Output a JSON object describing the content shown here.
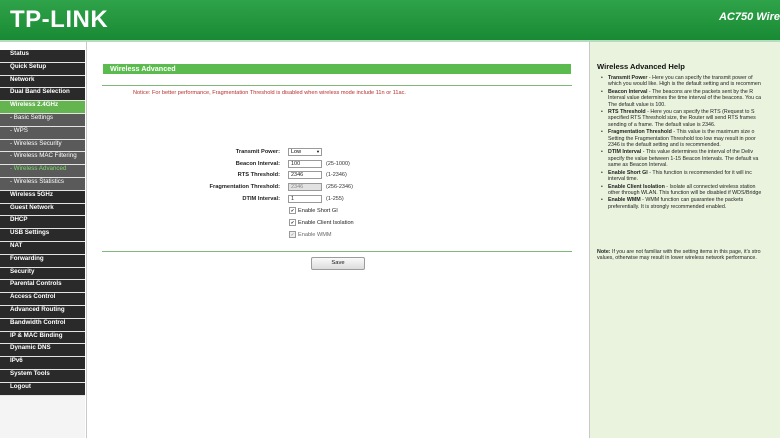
{
  "header": {
    "brand": "TP-LINK",
    "model": "AC750 Wire"
  },
  "sidebar": {
    "items": [
      {
        "label": "Status",
        "type": "top"
      },
      {
        "label": "Quick Setup",
        "type": "top"
      },
      {
        "label": "Network",
        "type": "top"
      },
      {
        "label": "Dual Band Selection",
        "type": "top"
      },
      {
        "label": "Wireless 2.4GHz",
        "type": "active"
      },
      {
        "label": "- Basic Settings",
        "type": "sub"
      },
      {
        "label": "- WPS",
        "type": "sub"
      },
      {
        "label": "- Wireless Security",
        "type": "sub"
      },
      {
        "label": "- Wireless MAC Filtering",
        "type": "sub"
      },
      {
        "label": "- Wireless Advanced",
        "type": "current"
      },
      {
        "label": "- Wireless Statistics",
        "type": "sub"
      },
      {
        "label": "Wireless 5GHz",
        "type": "top"
      },
      {
        "label": "Guest Network",
        "type": "top"
      },
      {
        "label": "DHCP",
        "type": "top"
      },
      {
        "label": "USB Settings",
        "type": "top"
      },
      {
        "label": "NAT",
        "type": "top"
      },
      {
        "label": "Forwarding",
        "type": "top"
      },
      {
        "label": "Security",
        "type": "top"
      },
      {
        "label": "Parental Controls",
        "type": "top"
      },
      {
        "label": "Access Control",
        "type": "top"
      },
      {
        "label": "Advanced Routing",
        "type": "top"
      },
      {
        "label": "Bandwidth Control",
        "type": "top"
      },
      {
        "label": "IP & MAC Binding",
        "type": "top"
      },
      {
        "label": "Dynamic DNS",
        "type": "top"
      },
      {
        "label": "IPv6",
        "type": "top"
      },
      {
        "label": "System Tools",
        "type": "top"
      },
      {
        "label": "Logout",
        "type": "top"
      }
    ]
  },
  "main": {
    "title": "Wireless Advanced",
    "notice": "Notice: For better performance, Fragmentation Threshold is disabled when wireless mode include 11n or 11ac.",
    "transmit_power": {
      "label": "Transmit Power:",
      "value": "Low"
    },
    "beacon_interval": {
      "label": "Beacon Interval:",
      "value": "100",
      "range": "(25-1000)"
    },
    "rts_threshold": {
      "label": "RTS Threshold:",
      "value": "2346",
      "range": "(1-2346)"
    },
    "frag_threshold": {
      "label": "Fragmentation Threshold:",
      "value": "2346",
      "range": "(256-2346)"
    },
    "dtim_interval": {
      "label": "DTIM Interval:",
      "value": "1",
      "range": "(1-255)"
    },
    "short_gi": {
      "label": "Enable Short GI",
      "checked": true
    },
    "client_isolation": {
      "label": "Enable Client Isolation",
      "checked": true
    },
    "wmm": {
      "label": "Enable WMM",
      "checked": true,
      "disabled": true
    },
    "save_label": "Save"
  },
  "help": {
    "title": "Wireless Advanced Help",
    "items": [
      [
        "Transmit Power",
        " - Here you can specify the transmit power of",
        "which you would like. High is the default setting and is recommen"
      ],
      [
        "Beacon Interval",
        " - The beacons are the packets sent by the R",
        "Interval value determines the time interval of the beacons. You ca",
        "The default value is 100."
      ],
      [
        "RTS Threshold",
        " - Here you can specify the RTS (Request to S",
        "specified RTS Threshold size, the Router will send RTS frames",
        "sending of a frame. The default value is 2346."
      ],
      [
        "Fragmentation Threshold",
        " - This value is the maximum size o",
        "Setting the Fragmentation Threshold too low may result in poor",
        "2346 is the default setting and is recommended."
      ],
      [
        "DTIM Interval",
        " - This value determines the interval of the Deliv",
        "specify the value between 1-15 Beacon Intervals. The default va",
        "same as Beacon Interval."
      ],
      [
        "Enable Short GI",
        " - This function is recommended for it will inc",
        "interval time."
      ],
      [
        "Enable Client Isolation",
        " - Isolate all connected wireless station",
        "other through WLAN. This function will be disabled if WDS/Bridge"
      ],
      [
        "Enable WMM",
        " - WMM function can guarantee the packets",
        "preferentially. It is strongly recommended enabled."
      ]
    ],
    "note": [
      "Note: If you are not familiar with the setting items in this page, it's stro",
      "values, otherwise may result in lower wireless network performance."
    ]
  }
}
